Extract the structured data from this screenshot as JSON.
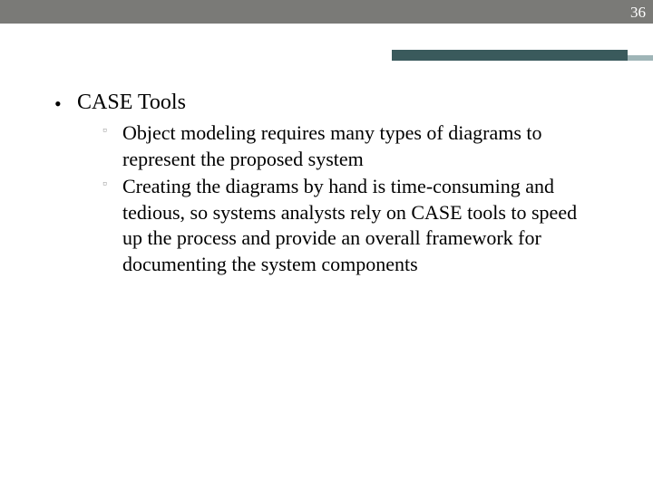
{
  "slideNumber": "36",
  "content": {
    "heading": "CASE Tools",
    "bullets": [
      "Object modeling requires many types of diagrams to represent the proposed system",
      "Creating the diagrams by hand is time-consuming and tedious, so systems analysts rely on CASE tools to speed up the process and provide an overall framework for documenting the system components"
    ]
  }
}
